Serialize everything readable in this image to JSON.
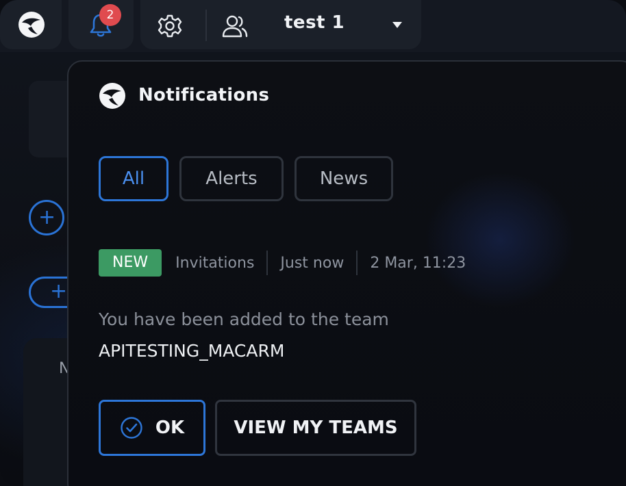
{
  "topbar": {
    "notification_count": "2",
    "team_name": "test 1",
    "icons": [
      "app-logo-icon",
      "bell-icon",
      "gear-icon",
      "users-icon",
      "caret-down-icon"
    ]
  },
  "background": {
    "partial_letter": "N"
  },
  "panel": {
    "title": "Notifications",
    "tabs": [
      {
        "label": "All",
        "active": true
      },
      {
        "label": "Alerts",
        "active": false
      },
      {
        "label": "News",
        "active": false
      }
    ],
    "notification": {
      "badge": "NEW",
      "category": "Invitations",
      "relative_time": "Just now",
      "timestamp": "2 Mar, 11:23",
      "message": "You have been added to the team",
      "team": "APITESTING_MACARM",
      "actions": {
        "ok_label": "OK",
        "view_teams_label": "VIEW MY TEAMS"
      }
    }
  },
  "colors": {
    "accent": "#2d76d8",
    "badge_red": "#e04b4f",
    "new_green": "#3c9a63"
  }
}
